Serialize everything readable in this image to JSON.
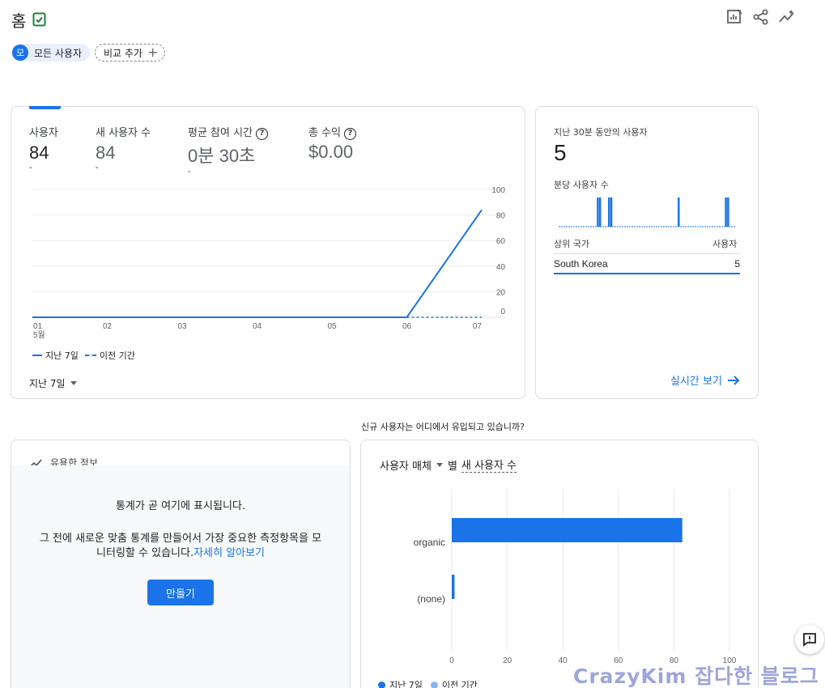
{
  "header": {
    "title": "홈",
    "icons": [
      "verified-check-icon",
      "customize-report-icon",
      "share-icon",
      "insights-icon"
    ]
  },
  "filters": {
    "all_users_avatar": "모",
    "all_users_label": "모든 사용자",
    "compare_label": "비교 추가"
  },
  "overview": {
    "metrics": [
      {
        "label": "사용자",
        "value": "84",
        "dash": "-"
      },
      {
        "label": "새 사용자 수",
        "value": "84",
        "dash": "-"
      },
      {
        "label": "평균 참여 시간",
        "value": "0분 30초",
        "dash": "-"
      },
      {
        "label": "총 수익",
        "value": "$0.00",
        "dash": ""
      }
    ],
    "chart_data": {
      "type": "line",
      "categories": [
        "01",
        "02",
        "03",
        "04",
        "05",
        "06",
        "07"
      ],
      "x_month_label": "5월",
      "series": [
        {
          "name": "지난 7일",
          "values": [
            0,
            0,
            0,
            0,
            0,
            0,
            84
          ],
          "style": "solid"
        },
        {
          "name": "이전 기간",
          "values": [
            0,
            0,
            0,
            0,
            0,
            0,
            0
          ],
          "style": "dashed"
        }
      ],
      "ylim": [
        0,
        100
      ],
      "y_ticks": [
        100,
        80,
        60,
        40,
        20,
        0
      ],
      "grid": true,
      "color": "#1a73e8"
    },
    "legend": [
      "지난 7일",
      "이전 기간"
    ],
    "period_label": "지난 7일"
  },
  "realtime": {
    "title": "지난 30분 동안의 사용자",
    "count": "5",
    "per_minute_label": "분당 사용자 수",
    "per_minute_bars": [
      0,
      0,
      0,
      0,
      0,
      0,
      0,
      0,
      0,
      0,
      0,
      0,
      0,
      0,
      0,
      0,
      0,
      1,
      1,
      0,
      0,
      0,
      1,
      1,
      0,
      0,
      0,
      0,
      0,
      0,
      0,
      0,
      0,
      0,
      0,
      0,
      0,
      0,
      0,
      0,
      0,
      0,
      0,
      0,
      0,
      0,
      0,
      0,
      0,
      0,
      0,
      0,
      0,
      1,
      0,
      0,
      0,
      0,
      0,
      0,
      0,
      0,
      0,
      0,
      0,
      0,
      0,
      0,
      0,
      0,
      0,
      0,
      0,
      0,
      1,
      1,
      0,
      0,
      0,
      0
    ],
    "col_country": "상위 국가",
    "col_users": "사용자",
    "rows": [
      {
        "country": "South Korea",
        "users": "5"
      }
    ],
    "view_link": "실시간 보기"
  },
  "acquisition": {
    "question": "신규 사용자는 어디에서 유입되고 있습니까?",
    "dimension_label": "사용자 매체",
    "suffix_label": "별",
    "metric_label": "새 사용자 수",
    "chart_data": {
      "type": "bar",
      "orientation": "horizontal",
      "categories": [
        "organic",
        "(none)"
      ],
      "series": [
        {
          "name": "지난 7일",
          "values": [
            83,
            1
          ],
          "color": "#1a73e8"
        },
        {
          "name": "이전 기간",
          "values": [
            0,
            0
          ],
          "color": "#8ab4f8"
        }
      ],
      "x_ticks": [
        0,
        20,
        40,
        60,
        80,
        100
      ],
      "xlim": [
        0,
        100
      ],
      "grid": true
    },
    "legend": [
      "지난 7일",
      "이전 기간"
    ]
  },
  "insights": {
    "title": "유용한 정보",
    "line1": "통계가 곧 여기에 표시됩니다.",
    "line2": "그 전에 새로운 맞춤 통계를 만들어서 가장 중요한 측정항목을 모",
    "line3": "니터링할 수 있습니다.",
    "learn_more": "자세히 알아보기",
    "create_button": "만들기"
  },
  "watermark": "CrazyKim 잡다한 블로그"
}
